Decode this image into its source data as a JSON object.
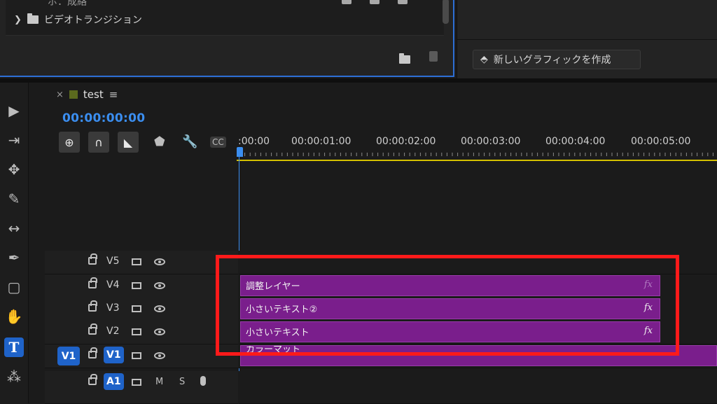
{
  "effects_panel": {
    "partial_item": "ポ：成絡",
    "tree_item": "ビデオトランジション"
  },
  "graphics_panel": {
    "new_graphic_button": "新しいグラフィックを作成"
  },
  "sequence": {
    "close_glyph": "×",
    "tab_name": "test",
    "menu_glyph": "≡",
    "timecode": "00:00:00:00",
    "ruler_labels": [
      ":00:00",
      "00:00:01:00",
      "00:00:02:00",
      "00:00:03:00",
      "00:00:04:00",
      "00:00:05:00"
    ],
    "tracks": {
      "v5": "V5",
      "v4": "V4",
      "v3": "V3",
      "v2": "V2",
      "v1": "V1",
      "a1": "A1",
      "source_v1": "V1",
      "mute": "M",
      "solo": "S"
    },
    "clips": {
      "adjustment_layer": "調整レイヤー",
      "small_text_2": "小さいテキスト②",
      "small_text": "小さいテキスト",
      "color_matte": "カラーマット",
      "fx": "fx"
    }
  },
  "colors": {
    "accent_blue": "#1f63c9",
    "clip_purple": "#7a1e8c",
    "highlight_red": "#ff1a1a",
    "timecode_blue": "#3b8ef0"
  }
}
